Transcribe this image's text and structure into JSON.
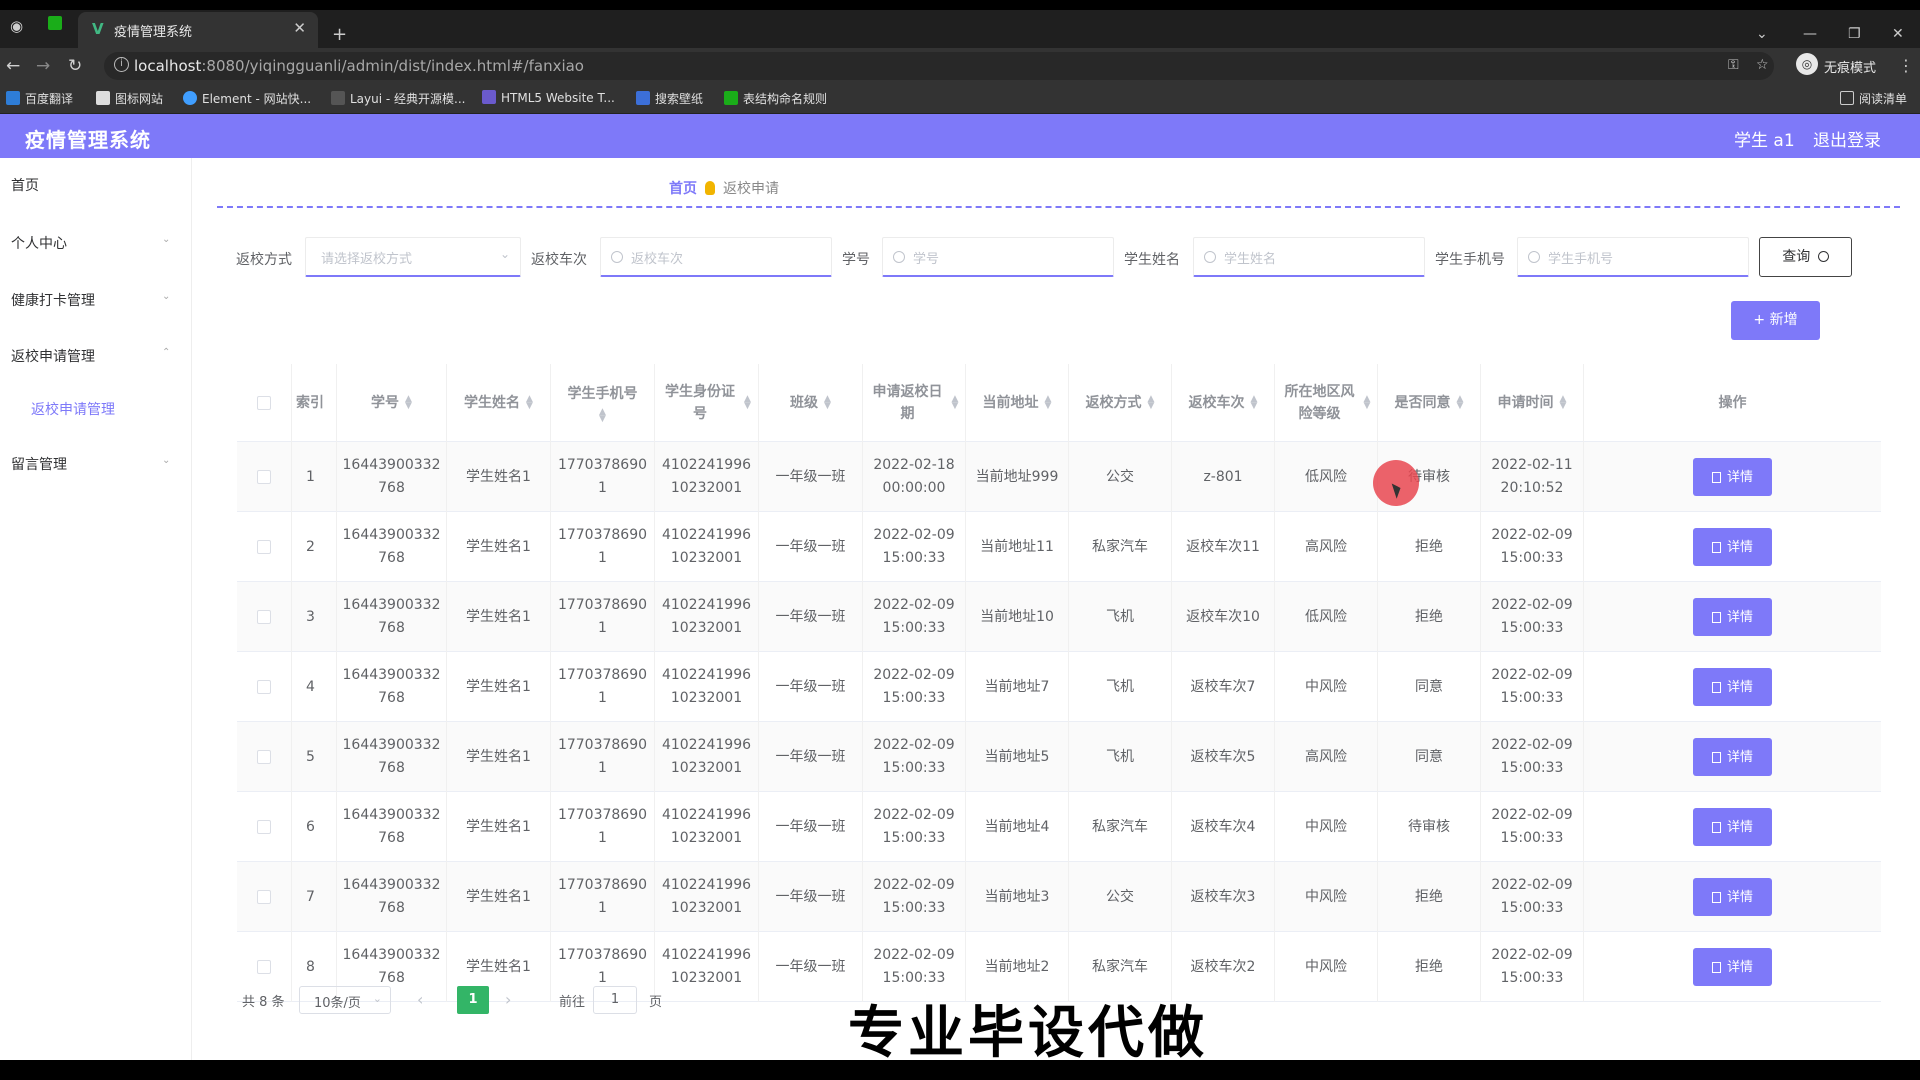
{
  "browser": {
    "tab_title": "疫情管理系统",
    "url_host": "localhost",
    "url_rest": ":8080/yiqingguanli/admin/dist/index.html#/fanxiao",
    "incognito_label": "无痕模式",
    "bookmarks": [
      "百度翻译",
      "图标网站",
      "Element - 网站快...",
      "Layui - 经典开源模...",
      "HTML5 Website T...",
      "搜索壁纸",
      "表结构命名规则"
    ],
    "reading_list": "阅读清单"
  },
  "header": {
    "brand": "疫情管理系统",
    "user": "学生 a1",
    "logout": "退出登录"
  },
  "sidebar": {
    "items": [
      "首页",
      "个人中心",
      "健康打卡管理",
      "返校申请管理",
      "留言管理"
    ],
    "sub_item": "返校申请管理"
  },
  "breadcrumb": {
    "home": "首页",
    "current": "返校申请"
  },
  "filters": {
    "mode_label": "返校方式",
    "mode_placeholder": "请选择返校方式",
    "trip_label": "返校车次",
    "trip_placeholder": "返校车次",
    "id_label": "学号",
    "id_placeholder": "学号",
    "name_label": "学生姓名",
    "name_placeholder": "学生姓名",
    "phone_label": "学生手机号",
    "phone_placeholder": "学生手机号",
    "query": "查询",
    "add": "+ 新增"
  },
  "table": {
    "columns": [
      "索引",
      "学号",
      "学生姓名",
      "学生手机号",
      "学生身份证号",
      "班级",
      "申请返校日期",
      "当前地址",
      "返校方式",
      "返校车次",
      "所在地区风险等级",
      "是否同意",
      "申请时间",
      "操作"
    ],
    "detail_label": "详情",
    "rows": [
      [
        "1",
        "16443900332768",
        "学生姓名1",
        "17703786901",
        "410224199610232001",
        "一年级一班",
        "2022-02-18 00:00:00",
        "当前地址999",
        "公交",
        "z-801",
        "低风险",
        "待审核",
        "2022-02-11 20:10:52"
      ],
      [
        "2",
        "16443900332768",
        "学生姓名1",
        "17703786901",
        "410224199610232001",
        "一年级一班",
        "2022-02-09 15:00:33",
        "当前地址11",
        "私家汽车",
        "返校车次11",
        "高风险",
        "拒绝",
        "2022-02-09 15:00:33"
      ],
      [
        "3",
        "16443900332768",
        "学生姓名1",
        "17703786901",
        "410224199610232001",
        "一年级一班",
        "2022-02-09 15:00:33",
        "当前地址10",
        "飞机",
        "返校车次10",
        "低风险",
        "拒绝",
        "2022-02-09 15:00:33"
      ],
      [
        "4",
        "16443900332768",
        "学生姓名1",
        "17703786901",
        "410224199610232001",
        "一年级一班",
        "2022-02-09 15:00:33",
        "当前地址7",
        "飞机",
        "返校车次7",
        "中风险",
        "同意",
        "2022-02-09 15:00:33"
      ],
      [
        "5",
        "16443900332768",
        "学生姓名1",
        "17703786901",
        "410224199610232001",
        "一年级一班",
        "2022-02-09 15:00:33",
        "当前地址5",
        "飞机",
        "返校车次5",
        "高风险",
        "同意",
        "2022-02-09 15:00:33"
      ],
      [
        "6",
        "16443900332768",
        "学生姓名1",
        "17703786901",
        "410224199610232001",
        "一年级一班",
        "2022-02-09 15:00:33",
        "当前地址4",
        "私家汽车",
        "返校车次4",
        "中风险",
        "待审核",
        "2022-02-09 15:00:33"
      ],
      [
        "7",
        "16443900332768",
        "学生姓名1",
        "17703786901",
        "410224199610232001",
        "一年级一班",
        "2022-02-09 15:00:33",
        "当前地址3",
        "公交",
        "返校车次3",
        "中风险",
        "拒绝",
        "2022-02-09 15:00:33"
      ],
      [
        "8",
        "16443900332768",
        "学生姓名1",
        "17703786901",
        "410224199610232001",
        "一年级一班",
        "2022-02-09 15:00:33",
        "当前地址2",
        "私家汽车",
        "返校车次2",
        "中风险",
        "拒绝",
        "2022-02-09 15:00:33"
      ]
    ]
  },
  "pagination": {
    "total": "共 8 条",
    "page_size": "10条/页",
    "current_page": "1",
    "goto_label": "前往",
    "goto_value": "1",
    "goto_unit": "页"
  },
  "overlay_caption": "专业毕设代做",
  "colors": {
    "accent": "#7e79f9",
    "page_active": "#33b567"
  }
}
